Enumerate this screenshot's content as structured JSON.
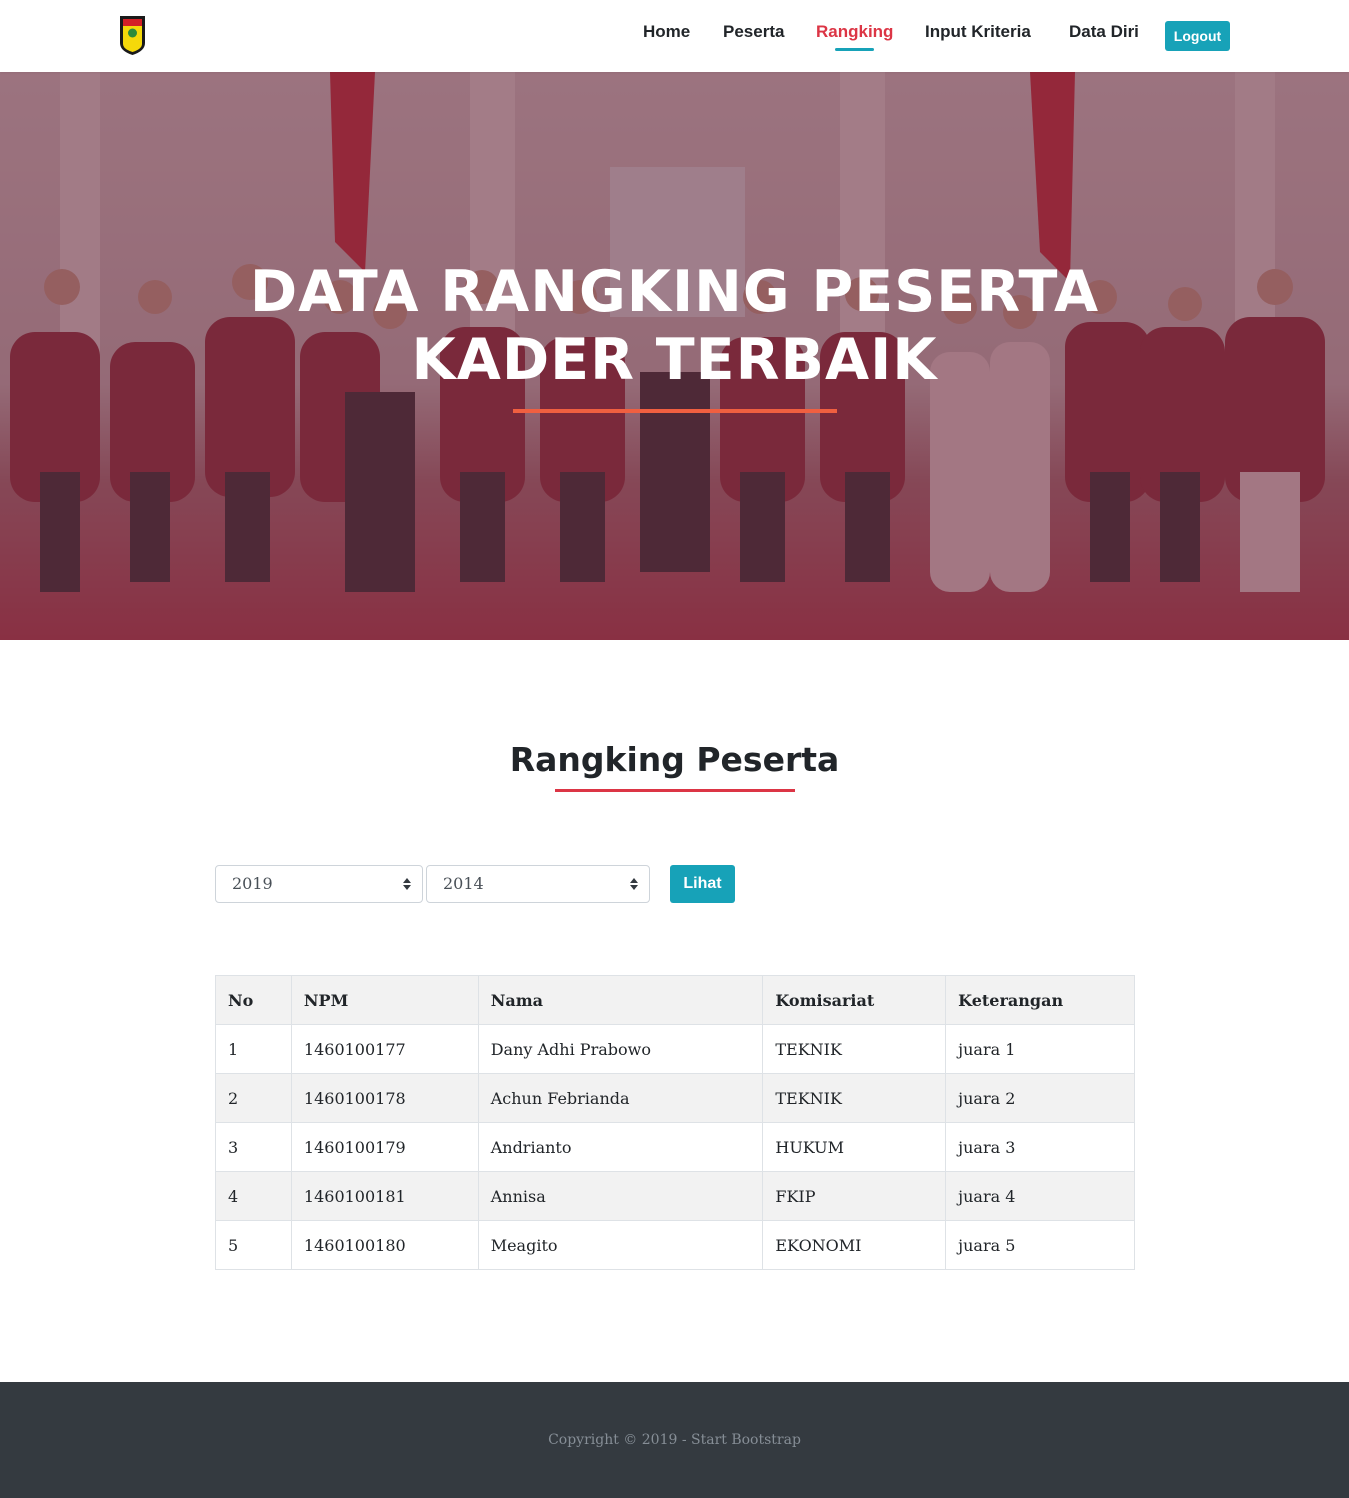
{
  "navbar": {
    "items": [
      {
        "label": "Home",
        "active": false
      },
      {
        "label": "Peserta",
        "active": false
      },
      {
        "label": "Rangking",
        "active": true
      },
      {
        "label": "Input Kriteria",
        "active": false
      },
      {
        "label": "Data Diri",
        "active": false
      }
    ],
    "logout_label": "Logout"
  },
  "hero": {
    "title_line1": "DATA RANGKING PESERTA",
    "title_line2": "KADER TERBAIK"
  },
  "section": {
    "title": "Rangking Peserta"
  },
  "filters": {
    "select_1_value": "2019",
    "select_2_value": "2014",
    "submit_label": "Lihat"
  },
  "table": {
    "headers": [
      "No",
      "NPM",
      "Nama",
      "Komisariat",
      "Keterangan"
    ],
    "rows": [
      [
        "1",
        "1460100177",
        "Dany Adhi Prabowo",
        "TEKNIK",
        "juara 1"
      ],
      [
        "2",
        "1460100178",
        "Achun Febrianda",
        "TEKNIK",
        "juara 2"
      ],
      [
        "3",
        "1460100179",
        "Andrianto",
        "HUKUM",
        "juara 3"
      ],
      [
        "4",
        "1460100181",
        "Annisa",
        "FKIP",
        "juara 4"
      ],
      [
        "5",
        "1460100180",
        "Meagito",
        "EKONOMI",
        "juara 5"
      ]
    ]
  },
  "footer": {
    "copyright": "Copyright © 2019 - Start Bootstrap"
  },
  "colors": {
    "accent": "#17a2b8",
    "active_nav": "#dc3545",
    "hero_divider": "#f05f40",
    "footer_bg": "#343a40"
  }
}
